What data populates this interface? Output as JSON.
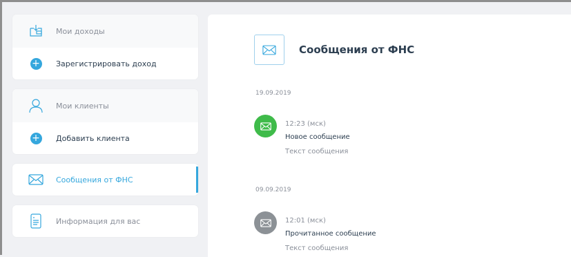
{
  "sidebar": {
    "income": {
      "title": "Мои доходы",
      "title_icon": "wallet-icon",
      "action": "Зарегистрировать доход",
      "action_icon": "plus-icon"
    },
    "clients": {
      "title": "Мои клиенты",
      "title_icon": "user-icon",
      "action": "Добавить клиента",
      "action_icon": "plus-icon"
    },
    "messages": {
      "label": "Сообщения от ФНС",
      "icon": "envelope-icon",
      "active": true
    },
    "info": {
      "label": "Информация для вас",
      "icon": "document-icon"
    }
  },
  "main": {
    "title": "Сообщения от ФНС",
    "title_icon": "envelope-icon",
    "groups": [
      {
        "date": "19.09.2019",
        "messages": [
          {
            "time": "12:23 (мск)",
            "title": "Новое сообщение",
            "body": "Текст сообщения",
            "status": "new",
            "color": "#3fbb4a"
          }
        ]
      },
      {
        "date": "09.09.2019",
        "messages": [
          {
            "time": "12:01 (мск)",
            "title": "Прочитанное сообщение",
            "body": "Текст сообщения",
            "status": "read",
            "color": "#8c9196"
          }
        ]
      }
    ]
  },
  "colors": {
    "accent": "#35a7dd",
    "background": "#f0f1f4",
    "text_dark": "#2c3e50",
    "text_muted": "#8a8f99"
  }
}
